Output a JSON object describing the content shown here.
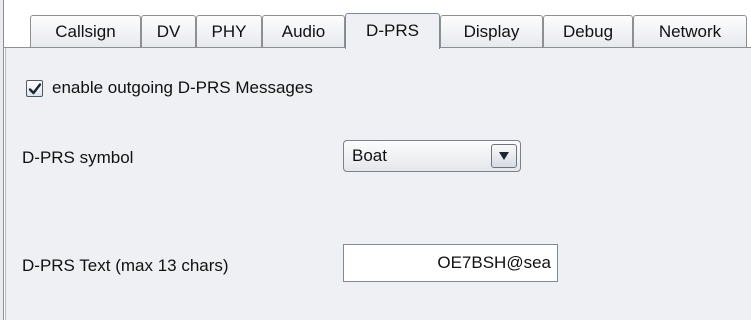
{
  "tabs": [
    {
      "label": "Callsign",
      "active": false
    },
    {
      "label": "DV",
      "active": false
    },
    {
      "label": "PHY",
      "active": false
    },
    {
      "label": "Audio",
      "active": false
    },
    {
      "label": "D-PRS",
      "active": true
    },
    {
      "label": "Display",
      "active": false
    },
    {
      "label": "Debug",
      "active": false
    },
    {
      "label": "Network",
      "active": false
    }
  ],
  "dprs": {
    "enable_checkbox": {
      "label": "enable outgoing D-PRS Messages",
      "checked": true,
      "icon": "check-icon"
    },
    "symbol": {
      "label": "D-PRS symbol",
      "value": "Boat",
      "dropdown_icon": "triangle-down-icon"
    },
    "text": {
      "label": "D-PRS Text (max 13 chars)",
      "value": "OE7BSH@sea"
    }
  },
  "colors": {
    "panel_background": "#eef0f3",
    "tab_border": "#8e8f8f"
  }
}
